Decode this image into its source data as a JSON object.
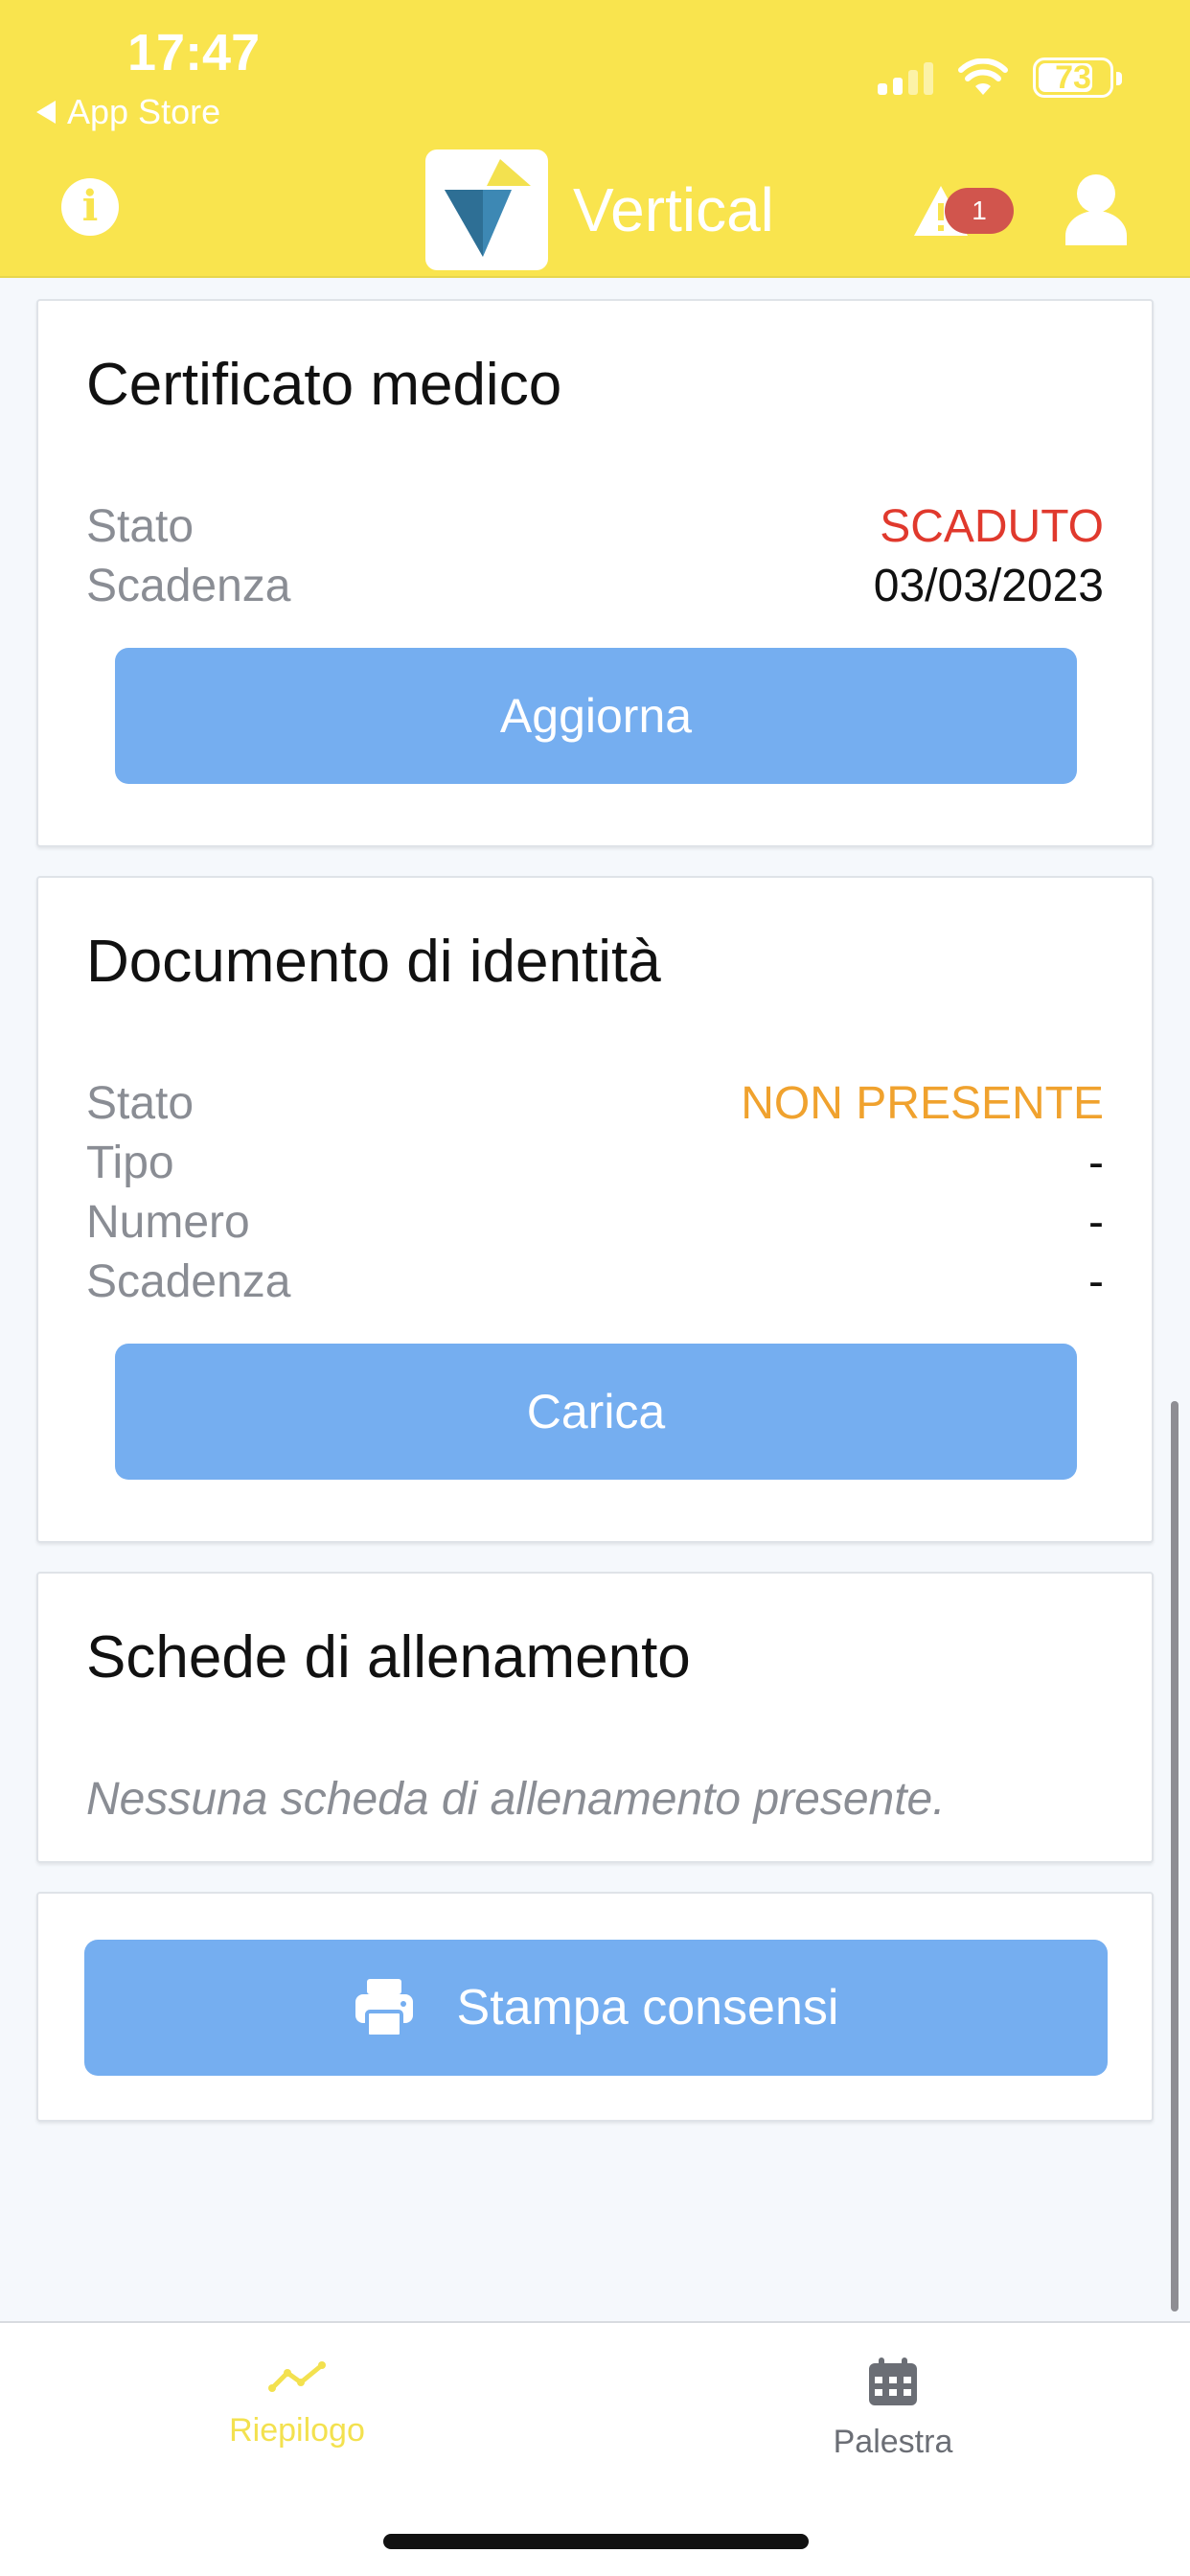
{
  "status_bar": {
    "time": "17:47",
    "back_label": "App Store",
    "battery": "73"
  },
  "header": {
    "app_name": "Vertical",
    "alert_count": "1"
  },
  "colors": {
    "header_bg": "#f9e44e",
    "button_bg": "#75aef0",
    "expired": "#e0392d",
    "missing": "#f0a22e",
    "active_tab": "#f3e14f"
  },
  "medical_certificate": {
    "title": "Certificato medico",
    "status_label": "Stato",
    "status_value": "SCADUTO",
    "expiry_label": "Scadenza",
    "expiry_value": "03/03/2023",
    "button": "Aggiorna"
  },
  "identity_document": {
    "title": "Documento di identità",
    "status_label": "Stato",
    "status_value": "NON PRESENTE",
    "type_label": "Tipo",
    "type_value": "-",
    "number_label": "Numero",
    "number_value": "-",
    "expiry_label": "Scadenza",
    "expiry_value": "-",
    "button": "Carica"
  },
  "training_sheets": {
    "title": "Schede di allenamento",
    "empty_message": "Nessuna scheda di allenamento presente."
  },
  "consents": {
    "button": "Stampa consensi",
    "icon": "printer-icon"
  },
  "tabbar": [
    {
      "label": "Riepilogo",
      "icon": "trend-line-icon",
      "active": true
    },
    {
      "label": "Palestra",
      "icon": "calendar-icon",
      "active": false
    }
  ]
}
